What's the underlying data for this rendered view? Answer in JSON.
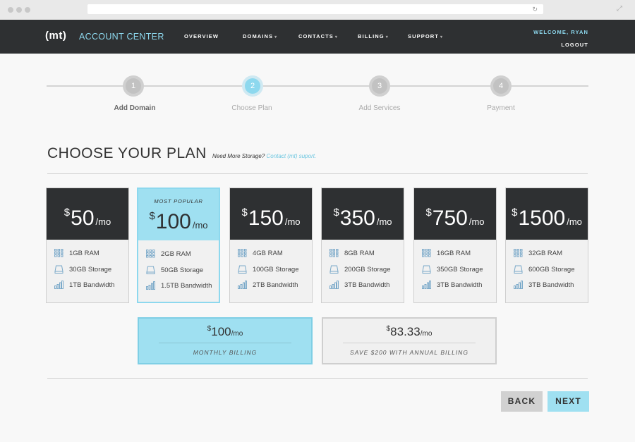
{
  "header": {
    "logo": "(mt)",
    "brand": "ACCOUNT CENTER",
    "nav": [
      {
        "label": "OVERVIEW",
        "caret": ""
      },
      {
        "label": "DOMAINS",
        "caret": "▾"
      },
      {
        "label": "CONTACTS",
        "caret": "▾"
      },
      {
        "label": "BILLING",
        "caret": "▾"
      },
      {
        "label": "SUPPORT",
        "caret": "▾"
      }
    ],
    "welcome": "WELCOME, RYAN",
    "logout": "LOGOUT"
  },
  "steps": [
    {
      "number": "1",
      "label": "Add Domain",
      "state": "done"
    },
    {
      "number": "2",
      "label": "Choose Plan",
      "state": "active"
    },
    {
      "number": "3",
      "label": "Add Services",
      "state": "pending"
    },
    {
      "number": "4",
      "label": "Payment",
      "state": "pending"
    }
  ],
  "title": "CHOOSE YOUR PLAN",
  "subtitle": {
    "text": "Need More Storage?",
    "link": "Contact (mt) suport."
  },
  "currency": "$",
  "per": "/mo",
  "plans": [
    {
      "price": "50",
      "tag": "",
      "ram": "1GB RAM",
      "storage": "30GB Storage",
      "bandwidth": "1TB Bandwidth"
    },
    {
      "price": "100",
      "tag": "MOST POPULAR",
      "ram": "2GB RAM",
      "storage": "50GB Storage",
      "bandwidth": "1.5TB Bandwidth"
    },
    {
      "price": "150",
      "tag": "",
      "ram": "4GB RAM",
      "storage": "100GB Storage",
      "bandwidth": "2TB Bandwidth"
    },
    {
      "price": "350",
      "tag": "",
      "ram": "8GB RAM",
      "storage": "200GB Storage",
      "bandwidth": "3TB Bandwidth"
    },
    {
      "price": "750",
      "tag": "",
      "ram": "16GB RAM",
      "storage": "350GB Storage",
      "bandwidth": "3TB Bandwidth"
    },
    {
      "price": "1500",
      "tag": "",
      "ram": "32GB RAM",
      "storage": "600GB Storage",
      "bandwidth": "3TB Bandwidth"
    }
  ],
  "billing": {
    "monthly": {
      "price": "100",
      "label": "MONTHLY BILLING"
    },
    "annual": {
      "price": "83.33",
      "label": "SAVE $200 WITH ANNUAL BILLING"
    }
  },
  "buttons": {
    "back": "BACK",
    "next": "NEXT"
  },
  "colors": {
    "accent": "#9fe0f1",
    "dark": "#2e3032",
    "brand": "#8dd8ee"
  }
}
